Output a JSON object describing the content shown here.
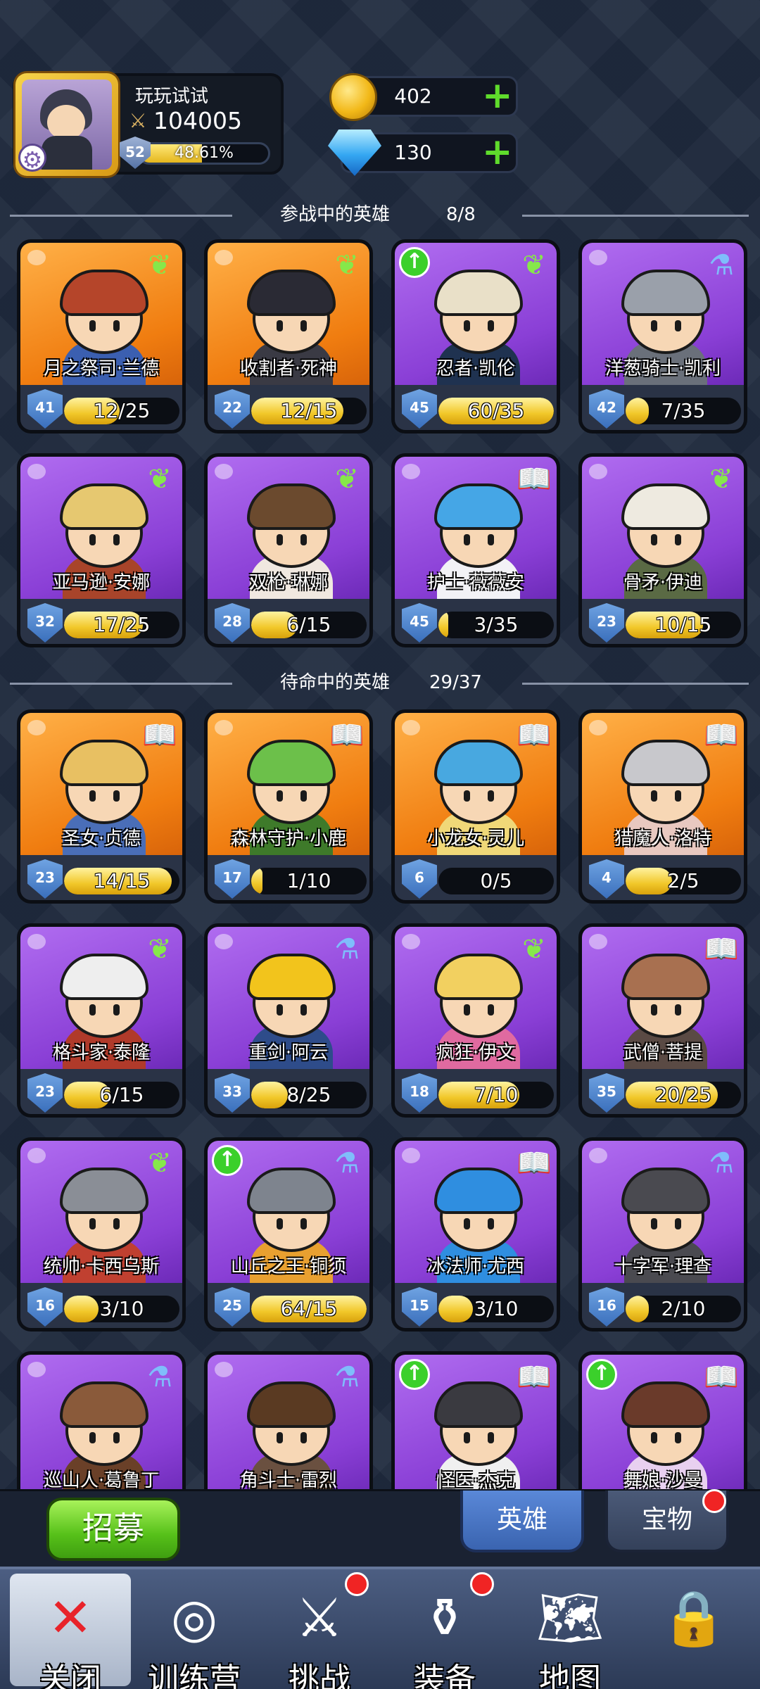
{
  "player": {
    "name": "玩玩试试",
    "power": "104005",
    "level": "52",
    "xp_text": "48.61%",
    "xp_fraction": 0.4861
  },
  "currency": {
    "gold": "402",
    "gems": "130"
  },
  "sections": {
    "active": {
      "label": "参战中的英雄",
      "count": "8/8"
    },
    "standby": {
      "label": "待命中的英雄",
      "count": "29/37"
    }
  },
  "active_heroes": [
    {
      "name": "月之祭司·兰德",
      "level": "41",
      "progress": "12/25",
      "fill": 0.48,
      "frame": "orange",
      "badge": "green",
      "upgrade": false,
      "hair": "#b5452a",
      "outfit": "#3b5fb0"
    },
    {
      "name": "收割者·死神",
      "level": "22",
      "progress": "12/15",
      "fill": 0.8,
      "frame": "orange",
      "badge": "green",
      "upgrade": false,
      "hair": "#2a2a34",
      "outfit": "#3a3a44"
    },
    {
      "name": "忍者·凯伦",
      "level": "45",
      "progress": "60/35",
      "fill": 1.0,
      "frame": "purple",
      "badge": "green",
      "upgrade": true,
      "hair": "#e9e0c8",
      "outfit": "#1f3250"
    },
    {
      "name": "洋葱骑士·凯利",
      "level": "42",
      "progress": "7/35",
      "fill": 0.2,
      "frame": "purple",
      "badge": "blue",
      "upgrade": false,
      "hair": "#9aa0aa",
      "outfit": "#6a707a"
    },
    {
      "name": "亚马逊·安娜",
      "level": "32",
      "progress": "17/25",
      "fill": 0.68,
      "frame": "purple",
      "badge": "green",
      "upgrade": false,
      "hair": "#e6c870",
      "outfit": "#a8442a"
    },
    {
      "name": "双枪·琳娜",
      "level": "28",
      "progress": "6/15",
      "fill": 0.4,
      "frame": "purple",
      "badge": "green",
      "upgrade": false,
      "hair": "#6b4a2e",
      "outfit": "#f0e8e0"
    },
    {
      "name": "护士·薇薇安",
      "level": "45",
      "progress": "3/35",
      "fill": 0.086,
      "frame": "purple",
      "badge": "gold",
      "upgrade": false,
      "hair": "#45a6e6",
      "outfit": "#f2f2f6"
    },
    {
      "name": "骨矛·伊迪",
      "level": "23",
      "progress": "10/15",
      "fill": 0.67,
      "frame": "purple",
      "badge": "green",
      "upgrade": false,
      "hair": "#eeeae0",
      "outfit": "#5a6a44"
    }
  ],
  "standby_heroes": [
    {
      "name": "圣女·贞德",
      "level": "23",
      "progress": "14/15",
      "fill": 0.93,
      "frame": "orange",
      "badge": "gold",
      "upgrade": false,
      "hair": "#e8c062",
      "outfit": "#4a6eb8"
    },
    {
      "name": "森林守护·小鹿",
      "level": "17",
      "progress": "1/10",
      "fill": 0.1,
      "frame": "orange",
      "badge": "gold",
      "upgrade": false,
      "hair": "#6cc04a",
      "outfit": "#3e7a2a"
    },
    {
      "name": "小龙女·灵儿",
      "level": "6",
      "progress": "0/5",
      "fill": 0,
      "frame": "orange",
      "badge": "gold",
      "upgrade": false,
      "hair": "#48a8e0",
      "outfit": "#f0d878"
    },
    {
      "name": "猎魔人·洛特",
      "level": "4",
      "progress": "2/5",
      "fill": 0.4,
      "frame": "orange",
      "badge": "gold",
      "upgrade": false,
      "hair": "#c8c8cc",
      "outfit": "#e8c8c0"
    },
    {
      "name": "格斗家·泰隆",
      "level": "23",
      "progress": "6/15",
      "fill": 0.4,
      "frame": "purple",
      "badge": "green",
      "upgrade": false,
      "hair": "#eeeeee",
      "outfit": "#b03a2a"
    },
    {
      "name": "重剑·阿云",
      "level": "33",
      "progress": "8/25",
      "fill": 0.32,
      "frame": "purple",
      "badge": "blue",
      "upgrade": false,
      "hair": "#f2c41c",
      "outfit": "#2e4c8a"
    },
    {
      "name": "疯狂·伊文",
      "level": "18",
      "progress": "7/10",
      "fill": 0.7,
      "frame": "purple",
      "badge": "green",
      "upgrade": false,
      "hair": "#f2d060",
      "outfit": "#e06aa0"
    },
    {
      "name": "武僧·菩提",
      "level": "35",
      "progress": "20/25",
      "fill": 0.8,
      "frame": "purple",
      "badge": "gold",
      "upgrade": false,
      "hair": "#a87050",
      "outfit": "#5a4a44"
    },
    {
      "name": "统帅·卡西乌斯",
      "level": "16",
      "progress": "3/10",
      "fill": 0.3,
      "frame": "purple",
      "badge": "green",
      "upgrade": false,
      "hair": "#8a8e96",
      "outfit": "#c04030"
    },
    {
      "name": "山丘之王·铜须",
      "level": "25",
      "progress": "64/15",
      "fill": 1.0,
      "frame": "purple",
      "badge": "blue",
      "upgrade": true,
      "hair": "#7e848e",
      "outfit": "#e8a030"
    },
    {
      "name": "冰法师·尤西",
      "level": "15",
      "progress": "3/10",
      "fill": 0.3,
      "frame": "purple",
      "badge": "gold",
      "upgrade": false,
      "hair": "#2f8ee0",
      "outfit": "#2f8ee0"
    },
    {
      "name": "十字军·理查",
      "level": "16",
      "progress": "2/10",
      "fill": 0.2,
      "frame": "purple",
      "badge": "blue",
      "upgrade": false,
      "hair": "#4a4a50",
      "outfit": "#4a4a50"
    },
    {
      "name": "巡山人·葛鲁丁",
      "level": "",
      "progress": "",
      "fill": 0,
      "frame": "purple",
      "badge": "blue",
      "upgrade": false,
      "hair": "#8a5a3a",
      "outfit": "#6a4028"
    },
    {
      "name": "角斗士·雷烈",
      "level": "",
      "progress": "",
      "fill": 0,
      "frame": "purple",
      "badge": "blue",
      "upgrade": false,
      "hair": "#5a3a22",
      "outfit": "#6a5040"
    },
    {
      "name": "怪医·杰克",
      "level": "",
      "progress": "",
      "fill": 0,
      "frame": "purple",
      "badge": "gold",
      "upgrade": true,
      "hair": "#3a3a40",
      "outfit": "#f0f0f0"
    },
    {
      "name": "舞娘·沙曼",
      "level": "",
      "progress": "",
      "fill": 0,
      "frame": "purple",
      "badge": "gold",
      "upgrade": true,
      "hair": "#6a3a2a",
      "outfit": "#e8d0f0"
    }
  ],
  "actions": {
    "recruit": "招募",
    "tab_heroes": "英雄",
    "tab_treasure": "宝物"
  },
  "nav": [
    {
      "label": "关闭",
      "icon": "close-icon",
      "glyph": "✕",
      "dot": false
    },
    {
      "label": "训练营",
      "icon": "training-target-icon",
      "glyph": "◎",
      "dot": false
    },
    {
      "label": "挑战",
      "icon": "sword-icon",
      "glyph": "⚔",
      "dot": true
    },
    {
      "label": "装备",
      "icon": "watering-can-icon",
      "glyph": "⚱",
      "dot": true
    },
    {
      "label": "地图",
      "icon": "map-icon",
      "glyph": "🗺",
      "dot": false
    },
    {
      "label": "",
      "icon": "locked-icon",
      "glyph": "🔒",
      "dot": false
    }
  ]
}
